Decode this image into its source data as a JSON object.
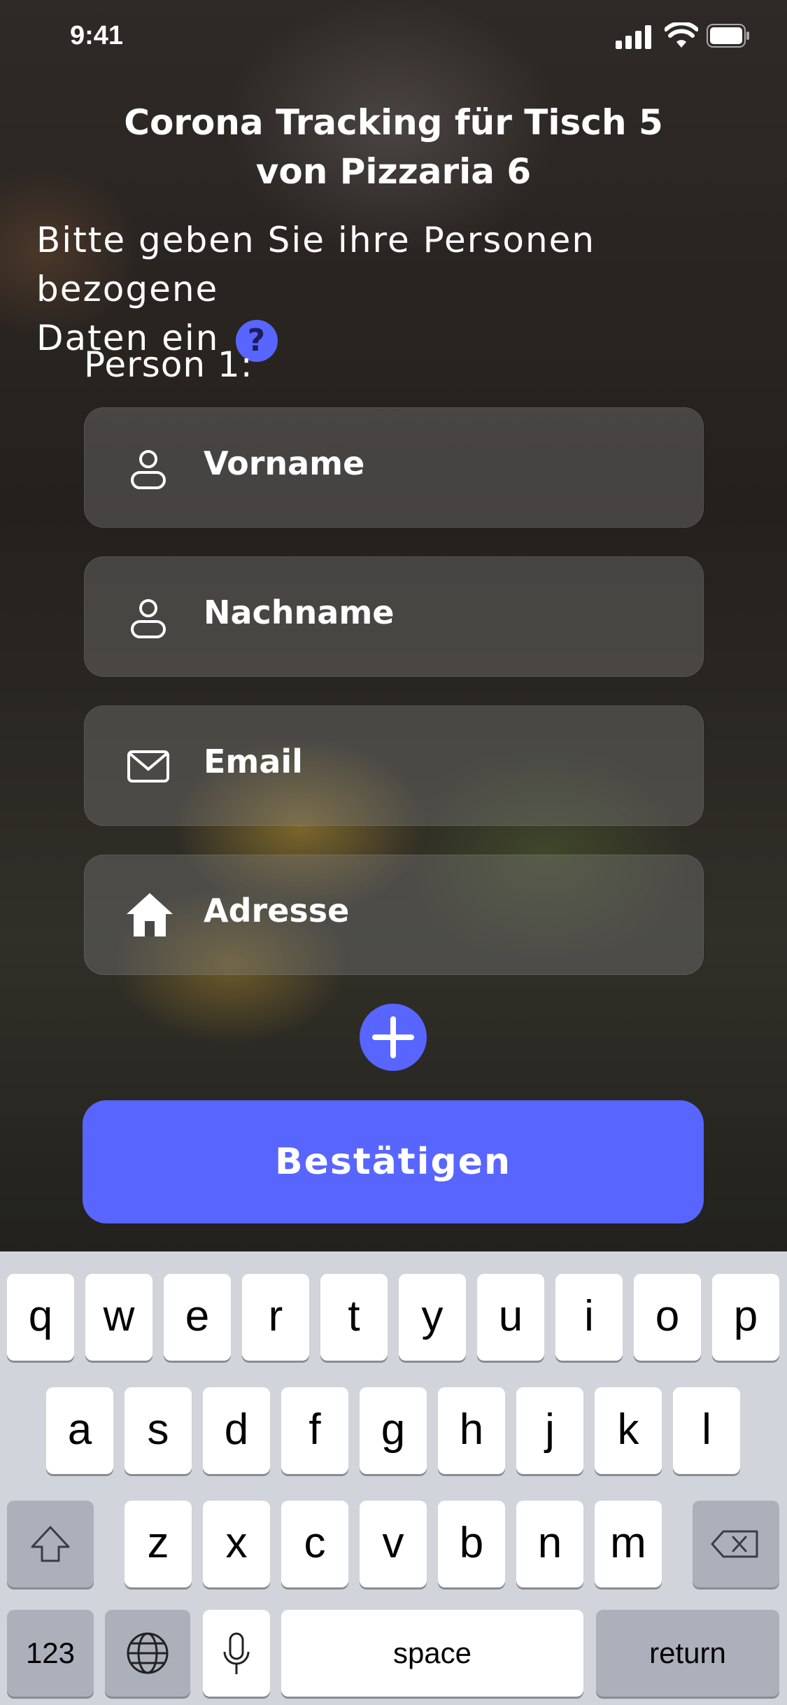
{
  "status_bar": {
    "time": "9:41"
  },
  "header": {
    "title_line1": "Corona Tracking für Tisch 5",
    "title_line2": "von Pizzaria 6",
    "subtitle_line1": "Bitte geben Sie ihre Personen bezogene",
    "subtitle_line2": "Daten ein",
    "help_glyph": "?"
  },
  "form": {
    "person_label": "Person 1:",
    "fields": [
      {
        "label": "Vorname",
        "icon": "user-icon"
      },
      {
        "label": "Nachname",
        "icon": "user-icon"
      },
      {
        "label": "Email",
        "icon": "mail-icon"
      },
      {
        "label": "Adresse",
        "icon": "home-icon"
      }
    ],
    "add_person_icon": "plus-icon",
    "confirm_label": "Bestätigen"
  },
  "colors": {
    "accent": "#5865ff"
  },
  "keyboard": {
    "row1": [
      "q",
      "w",
      "e",
      "r",
      "t",
      "y",
      "u",
      "i",
      "o",
      "p"
    ],
    "row2": [
      "a",
      "s",
      "d",
      "f",
      "g",
      "h",
      "j",
      "k",
      "l"
    ],
    "row3": [
      "z",
      "x",
      "c",
      "v",
      "b",
      "n",
      "m"
    ],
    "shift_icon": "shift-icon",
    "delete_icon": "delete-icon",
    "numbers_label": "123",
    "globe_icon": "globe-icon",
    "mic_icon": "microphone-icon",
    "space_label": "space",
    "return_label": "return"
  }
}
